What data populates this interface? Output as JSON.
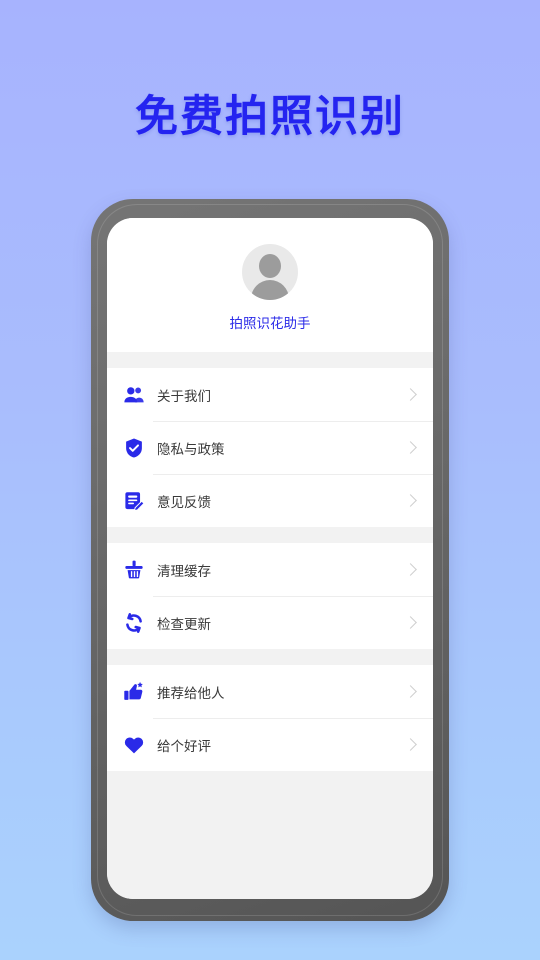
{
  "page": {
    "headline": "免费拍照识别",
    "accent_color": "#2424f0",
    "background_top": "#a7b3fe",
    "background_bottom": "#aad2fd",
    "frame_color": "#6b6b6b"
  },
  "profile": {
    "avatar_icon": "user-avatar-placeholder",
    "name": "拍照识花助手",
    "name_color": "#2c2ce8"
  },
  "groups": [
    {
      "items": [
        {
          "icon": "users-icon",
          "label": "关于我们",
          "chevron": "chevron-right-icon"
        },
        {
          "icon": "shield-check-icon",
          "label": "隐私与政策",
          "chevron": "chevron-right-icon"
        },
        {
          "icon": "feedback-edit-icon",
          "label": "意见反馈",
          "chevron": "chevron-right-icon"
        }
      ]
    },
    {
      "items": [
        {
          "icon": "broom-clean-icon",
          "label": "清理缓存",
          "chevron": "chevron-right-icon"
        },
        {
          "icon": "refresh-update-icon",
          "label": "检查更新",
          "chevron": "chevron-right-icon"
        }
      ]
    },
    {
      "items": [
        {
          "icon": "thumbs-up-star-icon",
          "label": "推荐给他人",
          "chevron": "chevron-right-icon"
        },
        {
          "icon": "heart-icon",
          "label": "给个好评",
          "chevron": "chevron-right-icon"
        }
      ]
    }
  ]
}
